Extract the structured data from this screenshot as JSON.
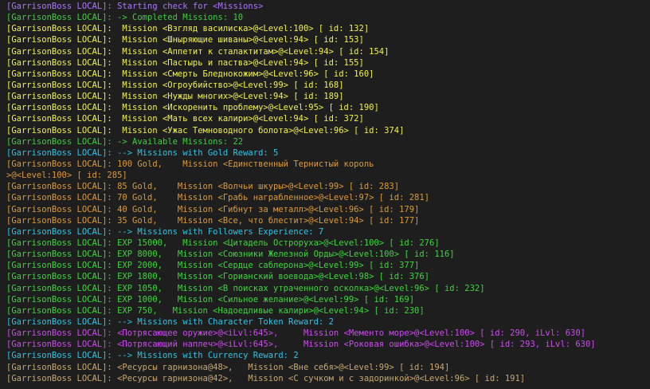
{
  "colors": {
    "purple": "#b074ff",
    "green": "#3ecf3e",
    "yellow": "#f2f24a",
    "cyan": "#29c6e8",
    "orange": "#dc9b34",
    "lime": "#3ad83a",
    "magenta": "#cd4bf0",
    "tan": "#c8a870"
  },
  "lines": [
    {
      "text": "[GarrisonBoss LOCAL]: Starting check for <Missions>",
      "color": "purple"
    },
    {
      "text": "[GarrisonBoss LOCAL]: -> Completed Missions: 10",
      "color": "green"
    },
    {
      "text": "[GarrisonBoss LOCAL]:  Mission <Взгляд василиска>@<Level:100> [ id: 132]",
      "color": "yellow"
    },
    {
      "text": "[GarrisonBoss LOCAL]:  Mission <Шныряющие шиваны>@<Level:94> [ id: 153]",
      "color": "yellow"
    },
    {
      "text": "[GarrisonBoss LOCAL]:  Mission <Аппетит к сталактитам>@<Level:94> [ id: 154]",
      "color": "yellow"
    },
    {
      "text": "[GarrisonBoss LOCAL]:  Mission <Пастырь и паства>@<Level:94> [ id: 155]",
      "color": "yellow"
    },
    {
      "text": "[GarrisonBoss LOCAL]:  Mission <Смерть Бледнокожим>@<Level:96> [ id: 160]",
      "color": "yellow"
    },
    {
      "text": "[GarrisonBoss LOCAL]:  Mission <Огроубийство>@<Level:99> [ id: 168]",
      "color": "yellow"
    },
    {
      "text": "[GarrisonBoss LOCAL]:  Mission <Нужды многих>@<Level:94> [ id: 189]",
      "color": "yellow"
    },
    {
      "text": "[GarrisonBoss LOCAL]:  Mission <Искоренить проблему>@<Level:95> [ id: 190]",
      "color": "yellow"
    },
    {
      "text": "[GarrisonBoss LOCAL]:  Mission <Мать всех калири>@<Level:94> [ id: 372]",
      "color": "yellow"
    },
    {
      "text": "[GarrisonBoss LOCAL]:  Mission <Ужас Темноводного болота>@<Level:96> [ id: 374]",
      "color": "yellow"
    },
    {
      "text": "[GarrisonBoss LOCAL]: -> Available Missions: 22",
      "color": "green"
    },
    {
      "text": "[GarrisonBoss LOCAL]: --> Missions with Gold Reward: 5",
      "color": "cyan"
    },
    {
      "text": "[GarrisonBoss LOCAL]: 100 Gold,    Mission <Единственный Тернистый король",
      "color": "orange"
    },
    {
      "text": ">@<Level:100> [ id: 285]",
      "color": "orange"
    },
    {
      "text": "[GarrisonBoss LOCAL]: 85 Gold,    Mission <Волчьи шкуры>@<Level:99> [ id: 283]",
      "color": "orange"
    },
    {
      "text": "[GarrisonBoss LOCAL]: 70 Gold,    Mission <Грабь награбленное>@<Level:97> [ id: 281]",
      "color": "orange"
    },
    {
      "text": "[GarrisonBoss LOCAL]: 40 Gold,    Mission <Гибнут за металл>@<Level:96> [ id: 179]",
      "color": "orange"
    },
    {
      "text": "[GarrisonBoss LOCAL]: 35 Gold,    Mission <Все, что блестит>@<Level:94> [ id: 177]",
      "color": "orange"
    },
    {
      "text": "[GarrisonBoss LOCAL]: --> Missions with Followers Experience: 7",
      "color": "cyan"
    },
    {
      "text": "[GarrisonBoss LOCAL]: EXP 15000,   Mission <Цитадель Остроруха>@<Level:100> [ id: 276]",
      "color": "lime"
    },
    {
      "text": "[GarrisonBoss LOCAL]: EXP 8000,   Mission <Союзники Железной Орды>@<Level:100> [ id: 116]",
      "color": "lime"
    },
    {
      "text": "[GarrisonBoss LOCAL]: EXP 2000,   Mission <Сердце саблерона>@<Level:99> [ id: 377]",
      "color": "lime"
    },
    {
      "text": "[GarrisonBoss LOCAL]: EXP 1800,   Mission <Горианский воевода>@<Level:98> [ id: 376]",
      "color": "lime"
    },
    {
      "text": "[GarrisonBoss LOCAL]: EXP 1050,   Mission <В поисках утраченного осколка>@<Level:96> [ id: 232]",
      "color": "lime"
    },
    {
      "text": "[GarrisonBoss LOCAL]: EXP 1000,   Mission <Сильное желание>@<Level:99> [ id: 169]",
      "color": "lime"
    },
    {
      "text": "[GarrisonBoss LOCAL]: EXP 750,   Mission <Надоедливые калири>@<Level:94> [ id: 230]",
      "color": "lime"
    },
    {
      "text": "[GarrisonBoss LOCAL]: --> Missions with Character Token Reward: 2",
      "color": "cyan"
    },
    {
      "text": "[GarrisonBoss LOCAL]: <Потрясающее оружие>@<iLvl:645>,     Mission <Мементо море>@<Level:100> [ id: 290, iLvl: 630]",
      "color": "magenta"
    },
    {
      "text": "[GarrisonBoss LOCAL]: <Потрясающий наплеч>@<iLvl:645>,     Mission <Роковая ошибка>@<Level:100> [ id: 293, iLvl: 630]",
      "color": "magenta"
    },
    {
      "text": "[GarrisonBoss LOCAL]: --> Missions with Currency Reward: 2",
      "color": "cyan"
    },
    {
      "text": "[GarrisonBoss LOCAL]: <Ресурсы гарнизона@48>,   Mission <Вне себя>@<Level:99> [ id: 194]",
      "color": "tan"
    },
    {
      "text": "[GarrisonBoss LOCAL]: <Ресурсы гарнизона@42>,   Mission <С сучком и с задоринкой>@<Level:96> [ id: 191]",
      "color": "tan"
    }
  ]
}
